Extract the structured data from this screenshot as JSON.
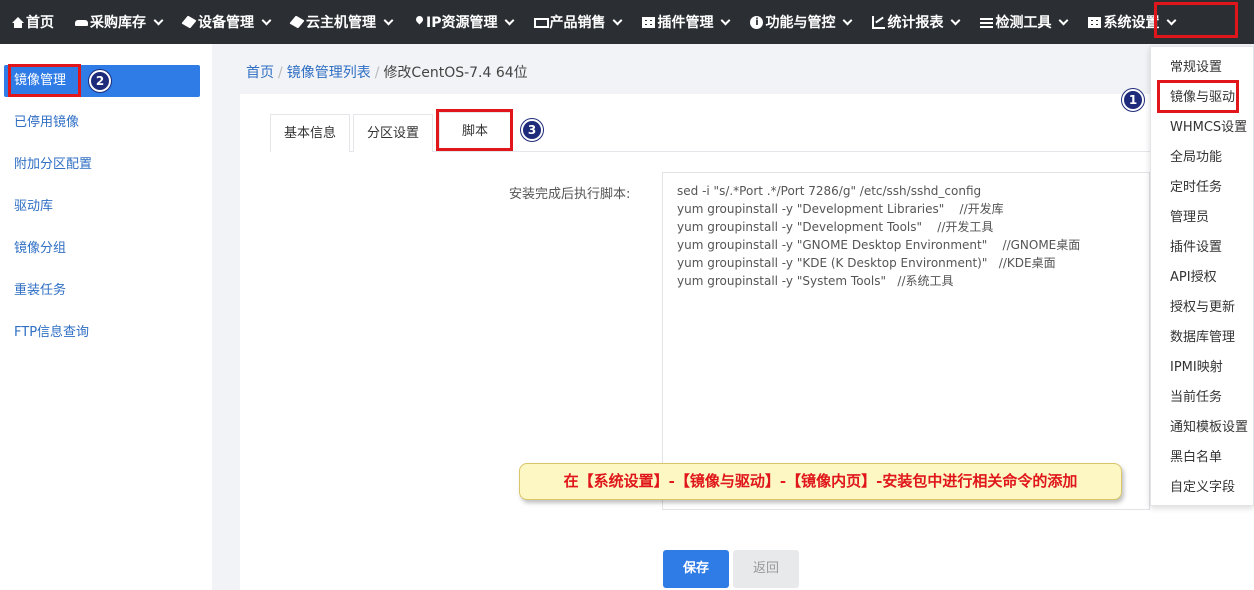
{
  "topnav": {
    "items": [
      {
        "label": "首页",
        "icon": "home-icon"
      },
      {
        "label": "采购库存",
        "icon": "car-icon"
      },
      {
        "label": "设备管理",
        "icon": "cube-icon"
      },
      {
        "label": "云主机管理",
        "icon": "cube-icon"
      },
      {
        "label": "IP资源管理",
        "icon": "map-pin-icon"
      },
      {
        "label": "产品销售",
        "icon": "cart-icon"
      },
      {
        "label": "插件管理",
        "icon": "grid-icon"
      },
      {
        "label": "功能与管控",
        "icon": "info-icon"
      },
      {
        "label": "统计报表",
        "icon": "chart-icon"
      },
      {
        "label": "检测工具",
        "icon": "list-icon"
      },
      {
        "label": "系统设置",
        "icon": "grid-icon"
      }
    ],
    "active": "系统设置"
  },
  "sidebar": {
    "items": [
      {
        "label": "镜像管理"
      },
      {
        "label": "已停用镜像"
      },
      {
        "label": "附加分区配置"
      },
      {
        "label": "驱动库"
      },
      {
        "label": "镜像分组"
      },
      {
        "label": "重装任务"
      },
      {
        "label": "FTP信息查询"
      }
    ],
    "active": "镜像管理"
  },
  "breadcrumb": {
    "home": "首页",
    "list": "镜像管理列表",
    "current": "修改CentOS-7.4 64位",
    "separator": "/"
  },
  "tabs": [
    {
      "label": "基本信息"
    },
    {
      "label": "分区设置"
    },
    {
      "label": "脚本"
    }
  ],
  "form": {
    "script_label": "安装完成后执行脚本:",
    "script_value": "sed -i \"s/.*Port .*/Port 7286/g\" /etc/ssh/sshd_config\nyum groupinstall -y \"Development Libraries\"    //开发库\nyum groupinstall -y \"Development Tools\"    //开发工具\nyum groupinstall -y \"GNOME Desktop Environment\"    //GNOME桌面\nyum groupinstall -y \"KDE (K Desktop Environment)\"   //KDE桌面\nyum groupinstall -y \"System Tools\"   //系统工具"
  },
  "buttons": {
    "save": "保存",
    "back": "返回"
  },
  "dropdown": {
    "items": [
      "常规设置",
      "镜像与驱动",
      "WHMCS设置",
      "全局功能",
      "定时任务",
      "管理员",
      "插件设置",
      "API授权",
      "授权与更新",
      "数据库管理",
      "IPMI映射",
      "当前任务",
      "通知模板设置",
      "黑白名单",
      "自定义字段"
    ]
  },
  "annotations": {
    "note": "在【系统设置】-【镜像与驱动】-【镜像内页】-安装包中进行相关命令的添加",
    "markers": [
      "1",
      "2",
      "3"
    ]
  },
  "colors": {
    "nav_bg": "#2b2f33",
    "accent": "#2f7ce6",
    "highlight_red": "#e0161b",
    "marker_navy": "#1e2a7a",
    "note_bg": "#fdf7c3"
  }
}
